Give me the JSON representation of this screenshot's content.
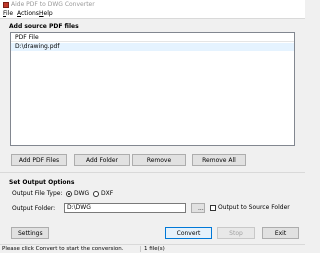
{
  "window": {
    "title": "Aide PDF to DWG Converter"
  },
  "menu": {
    "items": [
      "File",
      "Actions",
      "Help"
    ]
  },
  "source": {
    "section_title": "Add source PDF files",
    "column_header": "PDF File",
    "files": [
      "D:\\drawing.pdf"
    ],
    "buttons": {
      "add_pdf": "Add PDF Files",
      "add_folder": "Add Folder",
      "remove": "Remove",
      "remove_all": "Remove All"
    }
  },
  "output": {
    "section_title": "Set Output Options",
    "file_type_label": "Output File Type:",
    "file_type_options": [
      "DWG",
      "DXF"
    ],
    "file_type_selected": "DWG",
    "folder_label": "Output Folder:",
    "folder_value": "D:\\DWG",
    "browse_label": "...",
    "to_source_label": "Output to Source Folder",
    "to_source_checked": false
  },
  "actions": {
    "settings": "Settings",
    "convert": "Convert",
    "stop": "Stop",
    "exit": "Exit"
  },
  "status": {
    "message": "Please click Convert to start the conversion.",
    "file_count": "1 file(s)"
  },
  "colors": {
    "accent": "#0078d7",
    "selection": "#e5f3ff"
  }
}
